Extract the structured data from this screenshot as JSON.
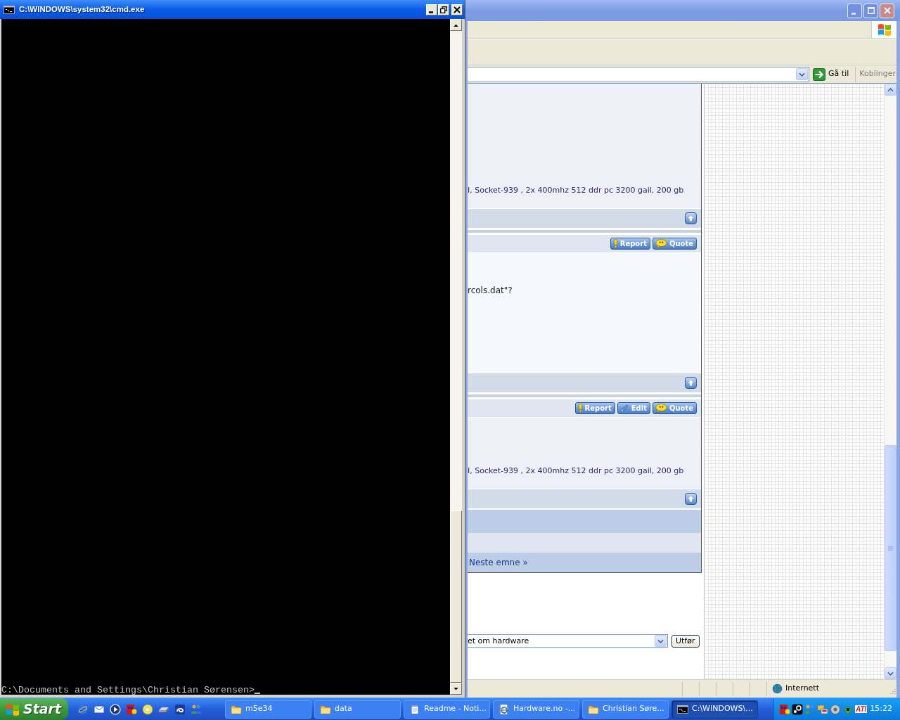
{
  "cmd_window": {
    "title": "C:\\WINDOWS\\system32\\cmd.exe",
    "active": true,
    "prompt": "C:\\Documents and Settings\\Christian Sørensen>"
  },
  "browser_window": {
    "active": false,
    "address_bar": {
      "go_button": "Gå til",
      "links": "Koblinger"
    },
    "posts": [
      {
        "signature": "I, Socket-939 , 2x 400mhz 512 ddr pc 3200 gail, 200 gb"
      },
      {
        "actions": [
          {
            "kind": "report",
            "label": "Report"
          },
          {
            "kind": "quote",
            "label": "Quote"
          }
        ],
        "text": "rcols.dat\"?"
      },
      {
        "actions": [
          {
            "kind": "report",
            "label": "Report"
          },
          {
            "kind": "edit",
            "label": "Edit"
          },
          {
            "kind": "quote",
            "label": "Quote"
          }
        ],
        "signature": "I, Socket-939 , 2x 400mhz 512 ddr pc 3200 gail, 200 gb"
      }
    ],
    "next_topic_link": "Neste emne »",
    "forum_jump": {
      "value": "et om hardware",
      "button": "Utfør"
    },
    "status_bar": {
      "zone": "Internett"
    }
  },
  "taskbar": {
    "start_button": "Start",
    "tasks": [
      {
        "kind": "folder",
        "label": "m5e34",
        "selected": false
      },
      {
        "kind": "folder",
        "label": "data",
        "selected": false
      },
      {
        "kind": "notepad",
        "label": "Readme - Noti...",
        "selected": false
      },
      {
        "kind": "browser",
        "label": "Hardware.no -...",
        "selected": false
      },
      {
        "kind": "folder",
        "label": "Christian Søre...",
        "selected": false
      },
      {
        "kind": "console",
        "label": "C:\\WINDOWS\\...",
        "selected": true
      }
    ],
    "tray": {
      "logo_text": "ATI",
      "clock": "15:22"
    }
  }
}
